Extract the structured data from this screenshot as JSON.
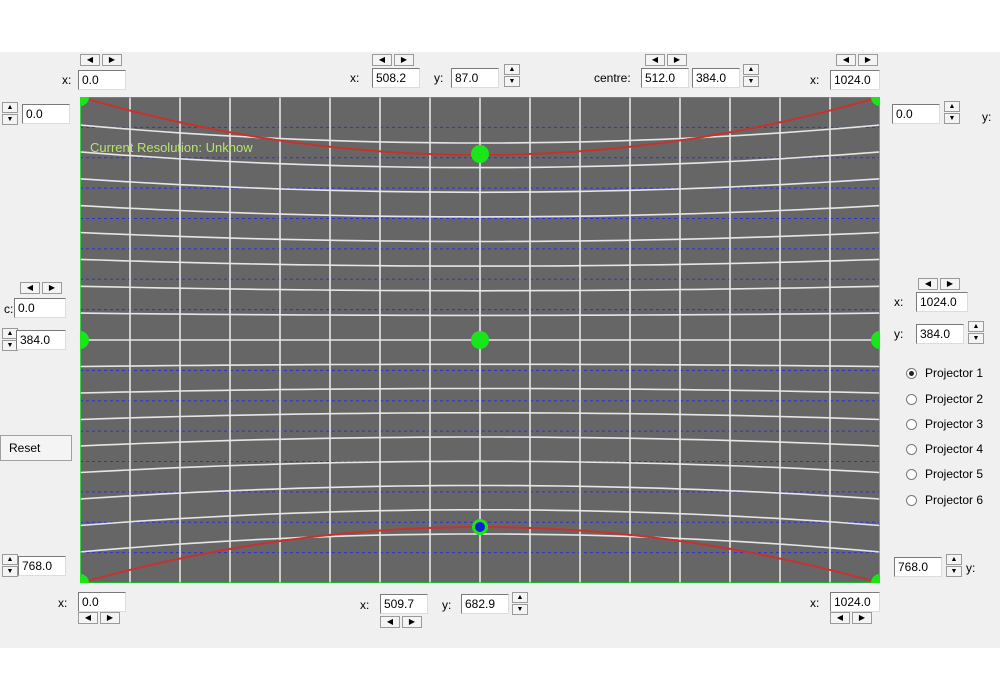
{
  "status_text": "Current Resolution: Unknow",
  "labels": {
    "x": "x:",
    "y": "y:",
    "centre": "centre:",
    "c": "c:"
  },
  "arrows": {
    "left": "◀",
    "right": "▶",
    "up": "▲",
    "down": "▼"
  },
  "top": {
    "left_x": "0.0",
    "mid_x": "508.2",
    "mid_y": "87.0",
    "centre_x": "512.0",
    "centre_y": "384.0",
    "right_x": "1024.0"
  },
  "left": {
    "top_y": "0.0",
    "mid_x": "0.0",
    "mid_y": "384.0",
    "bottom_y": "768.0"
  },
  "right": {
    "top_y": "0.0",
    "mid_x": "1024.0",
    "mid_y": "384.0",
    "bottom_y": "768.0"
  },
  "bottom": {
    "left_x": "0.0",
    "mid_x": "509.7",
    "mid_y": "682.9",
    "right_x": "1024.0"
  },
  "reset_label": "Reset",
  "projectors": [
    {
      "label": "Projector 1",
      "selected": true
    },
    {
      "label": "Projector 2",
      "selected": false
    },
    {
      "label": "Projector 3",
      "selected": false
    },
    {
      "label": "Projector 4",
      "selected": false
    },
    {
      "label": "Projector 5",
      "selected": false
    },
    {
      "label": "Projector 6",
      "selected": false
    }
  ],
  "colors": {
    "canvas_bg": "#666666",
    "grid": "#e6e6e6",
    "guide": "#2f33c9",
    "curve": "#c8322d",
    "handle": "#19e619",
    "selected_handle_center": "#1020d8"
  }
}
